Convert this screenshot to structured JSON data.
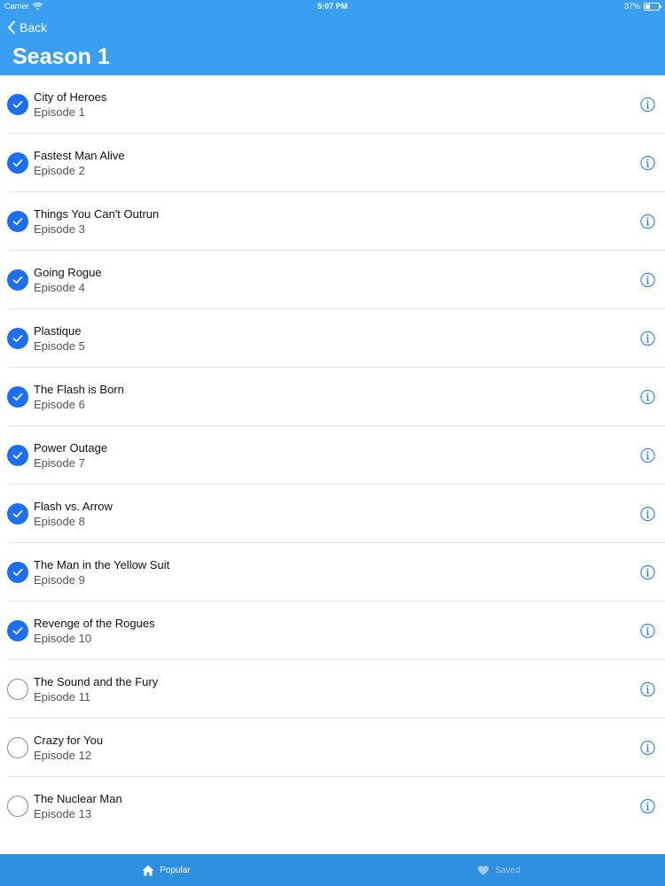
{
  "status_bar": {
    "carrier": "Carrier",
    "time": "5:07 PM",
    "battery": "37%",
    "battery_level": 0.37
  },
  "nav": {
    "back_label": "Back",
    "title": "Season 1"
  },
  "episodes": [
    {
      "title": "City of Heroes",
      "subtitle": "Episode 1",
      "watched": true
    },
    {
      "title": "Fastest Man Alive",
      "subtitle": "Episode 2",
      "watched": true
    },
    {
      "title": "Things You Can't Outrun",
      "subtitle": "Episode 3",
      "watched": true
    },
    {
      "title": "Going Rogue",
      "subtitle": "Episode 4",
      "watched": true
    },
    {
      "title": "Plastique",
      "subtitle": "Episode 5",
      "watched": true
    },
    {
      "title": "The Flash is Born",
      "subtitle": "Episode 6",
      "watched": true
    },
    {
      "title": "Power Outage",
      "subtitle": "Episode 7",
      "watched": true
    },
    {
      "title": "Flash vs. Arrow",
      "subtitle": "Episode 8",
      "watched": true
    },
    {
      "title": "The Man in the Yellow Suit",
      "subtitle": "Episode 9",
      "watched": true
    },
    {
      "title": "Revenge of the Rogues",
      "subtitle": "Episode 10",
      "watched": true
    },
    {
      "title": "The Sound and the Fury",
      "subtitle": "Episode 11",
      "watched": false
    },
    {
      "title": "Crazy for You",
      "subtitle": "Episode 12",
      "watched": false
    },
    {
      "title": "The Nuclear Man",
      "subtitle": "Episode 13",
      "watched": false
    }
  ],
  "tabs": [
    {
      "label": "Popular",
      "icon": "home-icon",
      "active": true
    },
    {
      "label": "Saved",
      "icon": "heart-icon",
      "active": false
    }
  ],
  "colors": {
    "header": "#3a9ff0",
    "tabbar": "#2f8fe0",
    "check_done": "#1d6ff0",
    "info_icon": "#2a7de1"
  }
}
